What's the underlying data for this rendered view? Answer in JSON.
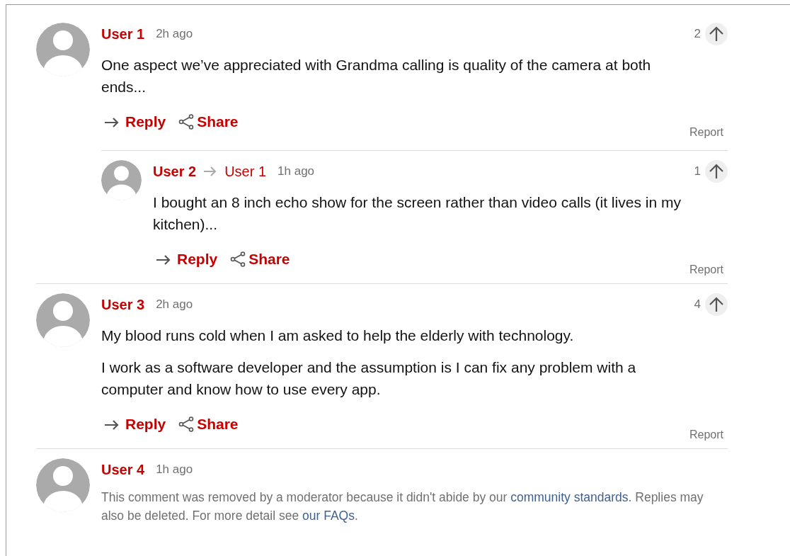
{
  "comments": [
    {
      "kind": "comment",
      "author": "User 1",
      "time": "2h ago",
      "votes": "2",
      "paragraphs": [
        "One aspect we’ve appreciated with Grandma calling is quality of the camera at both ends..."
      ],
      "reply": "Reply",
      "share": "Share",
      "report": "Report",
      "replies": [
        {
          "author": "User 2",
          "reply_to": "User 1",
          "time": "1h ago",
          "votes": "1",
          "paragraphs": [
            "I bought an 8 inch echo show for the screen rather than video calls (it lives in my kitchen)..."
          ],
          "reply": "Reply",
          "share": "Share",
          "report": "Report"
        }
      ]
    },
    {
      "kind": "comment",
      "author": "User 3",
      "time": "2h ago",
      "votes": "4",
      "paragraphs": [
        "My blood runs cold when I am asked to help the elderly with technology.",
        "I work as a software developer and the assumption is I can fix any problem with a computer and know how to use every app."
      ],
      "reply": "Reply",
      "share": "Share",
      "report": "Report"
    },
    {
      "kind": "removed",
      "author": "User 4",
      "time": "1h ago",
      "message": [
        {
          "kind": "text",
          "text": "This comment was removed by a moderator because it didn't abide by our "
        },
        {
          "kind": "link",
          "text": "community standards"
        },
        {
          "kind": "text",
          "text": ". Replies may also be deleted. For more detail see "
        },
        {
          "kind": "link",
          "text": "our FAQs"
        },
        {
          "kind": "text",
          "text": "."
        }
      ]
    }
  ]
}
